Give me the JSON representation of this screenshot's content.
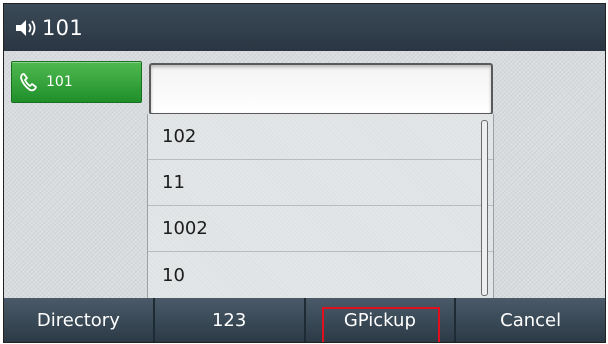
{
  "titlebar": {
    "icon": "speaker-icon",
    "title": "101"
  },
  "line_key": {
    "icon": "phone-icon",
    "label": "101",
    "color": "#2fa33a"
  },
  "input": {
    "value": ""
  },
  "dropdown": {
    "items": [
      "102",
      "11",
      "1002",
      "10"
    ]
  },
  "softkeys": [
    {
      "label": "Directory"
    },
    {
      "label": "123"
    },
    {
      "label": "GPickup",
      "highlighted": true,
      "highlight_color": "#e01020"
    },
    {
      "label": "Cancel"
    }
  ]
}
